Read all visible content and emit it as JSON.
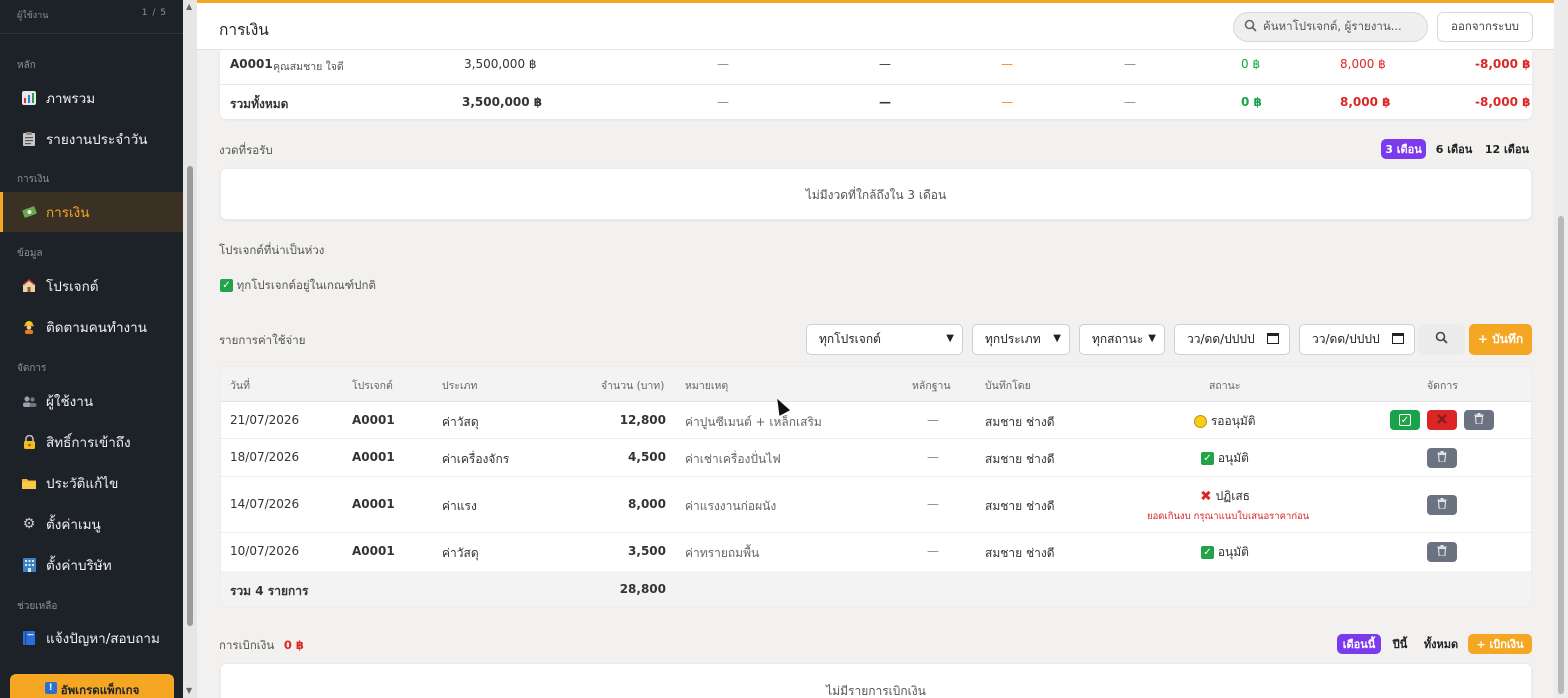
{
  "sidebar": {
    "user_label": "ผู้ใช้งาน",
    "user_count": "1 / 5",
    "sections": {
      "main": "หลัก",
      "finance": "การเงิน",
      "data": "ข้อมูล",
      "manage": "จัดการ",
      "help": "ช่วยเหลือ"
    },
    "items": {
      "overview": "ภาพรวม",
      "daily": "รายงานประจำวัน",
      "finance": "การเงิน",
      "projects": "โปรเจกต์",
      "workers": "ติดตามคนทำงาน",
      "users": "ผู้ใช้งาน",
      "access": "สิทธิ์การเข้าถึง",
      "history": "ประวัติแก้ไข",
      "menu_settings": "ตั้งค่าเมนู",
      "company": "ตั้งค่าบริษัท",
      "report": "แจ้งปัญหา/สอบถาม"
    },
    "upgrade_badge": "!",
    "upgrade": "อัพเกรดแพ็กเกจ",
    "active_color": "#f5a623"
  },
  "topbar": {
    "title": "การเงิน",
    "search_placeholder": "ค้นหาโปรเจกต์, ผู้รายงาน...",
    "logout": "ออกจากระบบ"
  },
  "summary": {
    "row": {
      "code": "A0001",
      "name": "คุณสมชาย ใจดี",
      "budget": "3,500,000 ฿",
      "c1": "—",
      "c2": "—",
      "c3": "—",
      "c4": "—",
      "received": "0 ฿",
      "spent": "8,000 ฿",
      "balance": "-8,000 ฿"
    },
    "total": {
      "label": "รวมทั้งหมด",
      "budget": "3,500,000 ฿",
      "c1": "—",
      "c2": "—",
      "c3": "—",
      "c4": "—",
      "received": "0 ฿",
      "spent": "8,000 ฿",
      "balance": "-8,000 ฿"
    }
  },
  "installments": {
    "label": "งวดที่รอรับ",
    "ranges": [
      "3 เดือน",
      "6 เดือน",
      "12 เดือน"
    ],
    "active_range": "3 เดือน",
    "empty": "ไม่มีงวดที่ใกล้ถึงใน 3 เดือน"
  },
  "concern": {
    "label": "โปรเจกต์ที่น่าเป็นห่วง",
    "ok_icon": "✓",
    "ok_text": "ทุกโปรเจกต์อยู่ในเกณฑ์ปกติ"
  },
  "expenses": {
    "label": "รายการค่าใช้จ่าย",
    "filters": {
      "project": "ทุกโปรเจกต์",
      "type": "ทุกประเภท",
      "status": "ทุกสถานะ",
      "date_from": "วว/ดด/ปปปป",
      "date_to": "วว/ดด/ปปปป"
    },
    "add_button": "+ บันทึก",
    "columns": {
      "date": "วันที่",
      "project": "โปรเจกต์",
      "type": "ประเภท",
      "amount": "จำนวน (บาท)",
      "note": "หมายเหตุ",
      "evidence": "หลักฐาน",
      "by": "บันทึกโดย",
      "status": "สถานะ",
      "manage": "จัดการ"
    },
    "rows": [
      {
        "date": "21/07/2026",
        "project": "A0001",
        "type": "ค่าวัสดุ",
        "amount": "12,800",
        "note": "ค่าปูนซีเมนต์ + เหล็กเสริม",
        "evidence": "—",
        "by": "สมชาย ช่างดี",
        "status": "รออนุมัติ",
        "reason": ""
      },
      {
        "date": "18/07/2026",
        "project": "A0001",
        "type": "ค่าเครื่องจักร",
        "amount": "4,500",
        "note": "ค่าเช่าเครื่องปั่นไฟ",
        "evidence": "—",
        "by": "สมชาย ช่างดี",
        "status": "อนุมัติ",
        "reason": ""
      },
      {
        "date": "14/07/2026",
        "project": "A0001",
        "type": "ค่าแรง",
        "amount": "8,000",
        "note": "ค่าแรงงานก่อผนัง",
        "evidence": "—",
        "by": "สมชาย ช่างดี",
        "status": "ปฏิเสธ",
        "reason": "ยอดเกินงบ กรุณาแนบใบเสนอราคาก่อน"
      },
      {
        "date": "10/07/2026",
        "project": "A0001",
        "type": "ค่าวัสดุ",
        "amount": "3,500",
        "note": "ค่าทรายถมพื้น",
        "evidence": "—",
        "by": "สมชาย ช่างดี",
        "status": "อนุมัติ",
        "reason": ""
      }
    ],
    "footer_label": "รวม 4 รายการ",
    "footer_total": "28,800"
  },
  "withdraw": {
    "label": "การเบิกเงิน",
    "amount": "0 ฿",
    "ranges": [
      "เดือนนี้",
      "ปีนี้",
      "ทั้งหมด"
    ],
    "active_range": "เดือนนี้",
    "add": "+ เบิกเงิน",
    "empty": "ไม่มีรายการเบิกเงิน"
  }
}
